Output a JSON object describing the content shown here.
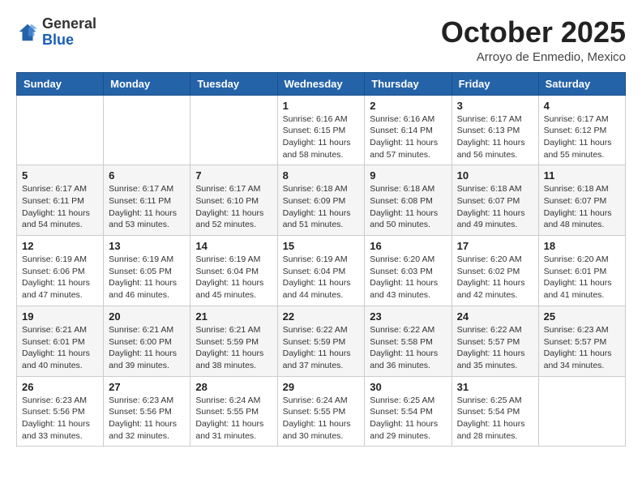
{
  "logo": {
    "general": "General",
    "blue": "Blue"
  },
  "header": {
    "month": "October 2025",
    "location": "Arroyo de Enmedio, Mexico"
  },
  "weekdays": [
    "Sunday",
    "Monday",
    "Tuesday",
    "Wednesday",
    "Thursday",
    "Friday",
    "Saturday"
  ],
  "weeks": [
    [
      {
        "day": "",
        "info": ""
      },
      {
        "day": "",
        "info": ""
      },
      {
        "day": "",
        "info": ""
      },
      {
        "day": "1",
        "info": "Sunrise: 6:16 AM\nSunset: 6:15 PM\nDaylight: 11 hours and 58 minutes."
      },
      {
        "day": "2",
        "info": "Sunrise: 6:16 AM\nSunset: 6:14 PM\nDaylight: 11 hours and 57 minutes."
      },
      {
        "day": "3",
        "info": "Sunrise: 6:17 AM\nSunset: 6:13 PM\nDaylight: 11 hours and 56 minutes."
      },
      {
        "day": "4",
        "info": "Sunrise: 6:17 AM\nSunset: 6:12 PM\nDaylight: 11 hours and 55 minutes."
      }
    ],
    [
      {
        "day": "5",
        "info": "Sunrise: 6:17 AM\nSunset: 6:11 PM\nDaylight: 11 hours and 54 minutes."
      },
      {
        "day": "6",
        "info": "Sunrise: 6:17 AM\nSunset: 6:11 PM\nDaylight: 11 hours and 53 minutes."
      },
      {
        "day": "7",
        "info": "Sunrise: 6:17 AM\nSunset: 6:10 PM\nDaylight: 11 hours and 52 minutes."
      },
      {
        "day": "8",
        "info": "Sunrise: 6:18 AM\nSunset: 6:09 PM\nDaylight: 11 hours and 51 minutes."
      },
      {
        "day": "9",
        "info": "Sunrise: 6:18 AM\nSunset: 6:08 PM\nDaylight: 11 hours and 50 minutes."
      },
      {
        "day": "10",
        "info": "Sunrise: 6:18 AM\nSunset: 6:07 PM\nDaylight: 11 hours and 49 minutes."
      },
      {
        "day": "11",
        "info": "Sunrise: 6:18 AM\nSunset: 6:07 PM\nDaylight: 11 hours and 48 minutes."
      }
    ],
    [
      {
        "day": "12",
        "info": "Sunrise: 6:19 AM\nSunset: 6:06 PM\nDaylight: 11 hours and 47 minutes."
      },
      {
        "day": "13",
        "info": "Sunrise: 6:19 AM\nSunset: 6:05 PM\nDaylight: 11 hours and 46 minutes."
      },
      {
        "day": "14",
        "info": "Sunrise: 6:19 AM\nSunset: 6:04 PM\nDaylight: 11 hours and 45 minutes."
      },
      {
        "day": "15",
        "info": "Sunrise: 6:19 AM\nSunset: 6:04 PM\nDaylight: 11 hours and 44 minutes."
      },
      {
        "day": "16",
        "info": "Sunrise: 6:20 AM\nSunset: 6:03 PM\nDaylight: 11 hours and 43 minutes."
      },
      {
        "day": "17",
        "info": "Sunrise: 6:20 AM\nSunset: 6:02 PM\nDaylight: 11 hours and 42 minutes."
      },
      {
        "day": "18",
        "info": "Sunrise: 6:20 AM\nSunset: 6:01 PM\nDaylight: 11 hours and 41 minutes."
      }
    ],
    [
      {
        "day": "19",
        "info": "Sunrise: 6:21 AM\nSunset: 6:01 PM\nDaylight: 11 hours and 40 minutes."
      },
      {
        "day": "20",
        "info": "Sunrise: 6:21 AM\nSunset: 6:00 PM\nDaylight: 11 hours and 39 minutes."
      },
      {
        "day": "21",
        "info": "Sunrise: 6:21 AM\nSunset: 5:59 PM\nDaylight: 11 hours and 38 minutes."
      },
      {
        "day": "22",
        "info": "Sunrise: 6:22 AM\nSunset: 5:59 PM\nDaylight: 11 hours and 37 minutes."
      },
      {
        "day": "23",
        "info": "Sunrise: 6:22 AM\nSunset: 5:58 PM\nDaylight: 11 hours and 36 minutes."
      },
      {
        "day": "24",
        "info": "Sunrise: 6:22 AM\nSunset: 5:57 PM\nDaylight: 11 hours and 35 minutes."
      },
      {
        "day": "25",
        "info": "Sunrise: 6:23 AM\nSunset: 5:57 PM\nDaylight: 11 hours and 34 minutes."
      }
    ],
    [
      {
        "day": "26",
        "info": "Sunrise: 6:23 AM\nSunset: 5:56 PM\nDaylight: 11 hours and 33 minutes."
      },
      {
        "day": "27",
        "info": "Sunrise: 6:23 AM\nSunset: 5:56 PM\nDaylight: 11 hours and 32 minutes."
      },
      {
        "day": "28",
        "info": "Sunrise: 6:24 AM\nSunset: 5:55 PM\nDaylight: 11 hours and 31 minutes."
      },
      {
        "day": "29",
        "info": "Sunrise: 6:24 AM\nSunset: 5:55 PM\nDaylight: 11 hours and 30 minutes."
      },
      {
        "day": "30",
        "info": "Sunrise: 6:25 AM\nSunset: 5:54 PM\nDaylight: 11 hours and 29 minutes."
      },
      {
        "day": "31",
        "info": "Sunrise: 6:25 AM\nSunset: 5:54 PM\nDaylight: 11 hours and 28 minutes."
      },
      {
        "day": "",
        "info": ""
      }
    ]
  ]
}
